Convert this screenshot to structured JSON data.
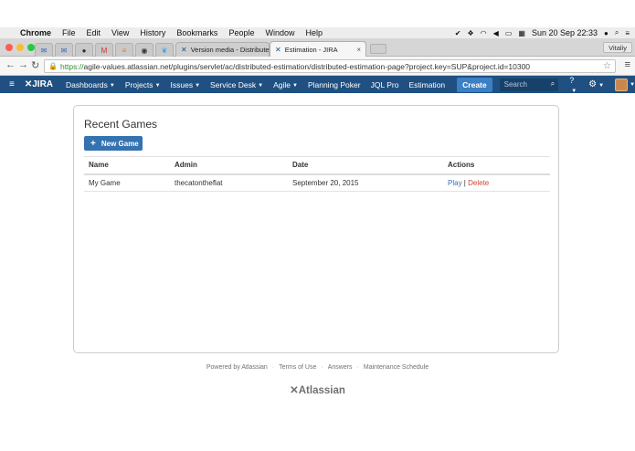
{
  "mac_menubar": {
    "apple_glyph": "",
    "items": [
      "Chrome",
      "File",
      "Edit",
      "View",
      "History",
      "Bookmarks",
      "People",
      "Window",
      "Help"
    ],
    "clock": "Sun 20 Sep  22:33"
  },
  "browser": {
    "tabs": [
      {
        "title": "Version media - Distributed",
        "active": false
      },
      {
        "title": "Estimation - JIRA",
        "active": true
      }
    ],
    "profile": "Vitaliy",
    "url_scheme": "https://",
    "url_rest": "agile-values.atlassian.net/plugins/servlet/ac/distributed-estimation/distributed-estimation-page?project.key=SUP&project.id=10300"
  },
  "jira": {
    "logo": "JIRA",
    "nav": [
      "Dashboards",
      "Projects",
      "Issues",
      "Service Desk",
      "Agile",
      "Planning Poker",
      "JQL Pro",
      "Estimation"
    ],
    "nav_dropdown": [
      true,
      true,
      true,
      true,
      true,
      false,
      false,
      false
    ],
    "create": "Create",
    "search_placeholder": "Search",
    "help_icon": "?"
  },
  "page": {
    "title": "Recent Games",
    "new_game": "New Game",
    "columns": [
      "Name",
      "Admin",
      "Date",
      "Actions"
    ],
    "rows": [
      {
        "name": "My Game",
        "admin": "thecatontheflat",
        "date": "September 20, 2015",
        "play": "Play",
        "sep": "|",
        "delete": "Delete"
      }
    ]
  },
  "footer": {
    "links": [
      "Powered by Atlassian",
      "Terms of Use",
      "Answers",
      "Maintenance Schedule"
    ],
    "brand": "Atlassian"
  },
  "colors": {
    "jira_header": "#205081",
    "primary_button": "#3572b0",
    "delete_link": "#d04437"
  }
}
